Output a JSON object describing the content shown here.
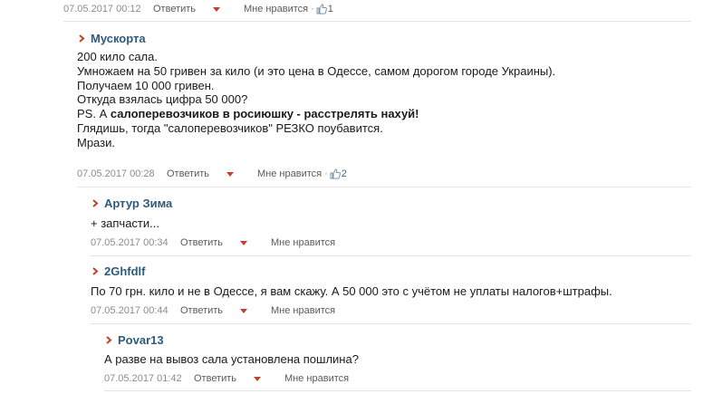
{
  "top": {
    "date": "07.05.2017 00:12",
    "reply_label": "Ответить",
    "like_label": "Мне нравится",
    "like_count": "1"
  },
  "comments": [
    {
      "author": "Мускорта",
      "lines": [
        "200 кило сала.",
        "Умножаем на 50 гривен за кило (и это цена в Одессе, самом дорогом городе Украины).",
        "Получаем 10 000 гривен.",
        "Откуда взялась цифра 50 000?",
        "PS. А ",
        "салоперевозчиков в росиюшку - расстрелять нахуй!",
        "Глядишь, тогда \"салоперевозчиков\" РЕЗКО поубавится.",
        "Мрази."
      ],
      "date": "07.05.2017 00:28",
      "reply_label": "Ответить",
      "like_label": "Мне нравится",
      "like_count": "2"
    },
    {
      "author": "Артур Зима",
      "lines": [
        "+ запчасти..."
      ],
      "date": "07.05.2017 00:34",
      "reply_label": "Ответить",
      "like_label": "Мне нравится"
    },
    {
      "author": "2Ghfdlf",
      "lines": [
        "По 70 грн. кило и не в Одессе, я вам скажу. А 50 000 это с учётом не уплаты налогов+штрафы."
      ],
      "date": "07.05.2017 00:44",
      "reply_label": "Ответить",
      "like_label": "Мне нравится"
    },
    {
      "author": "Povar13",
      "lines": [
        "А разве на вывоз сала установлена пошлина?"
      ],
      "date": "07.05.2017 01:42",
      "reply_label": "Ответить",
      "like_label": "Мне нравится"
    }
  ],
  "colors": {
    "author": "#2e5a7c",
    "arrow": "#c2402b",
    "meta": "#8c8c8c",
    "separator": "#e3e3e3"
  },
  "icons": {
    "author_marker": "chevron-right-icon",
    "menu": "caret-down-icon",
    "like": "thumbs-up-icon"
  }
}
